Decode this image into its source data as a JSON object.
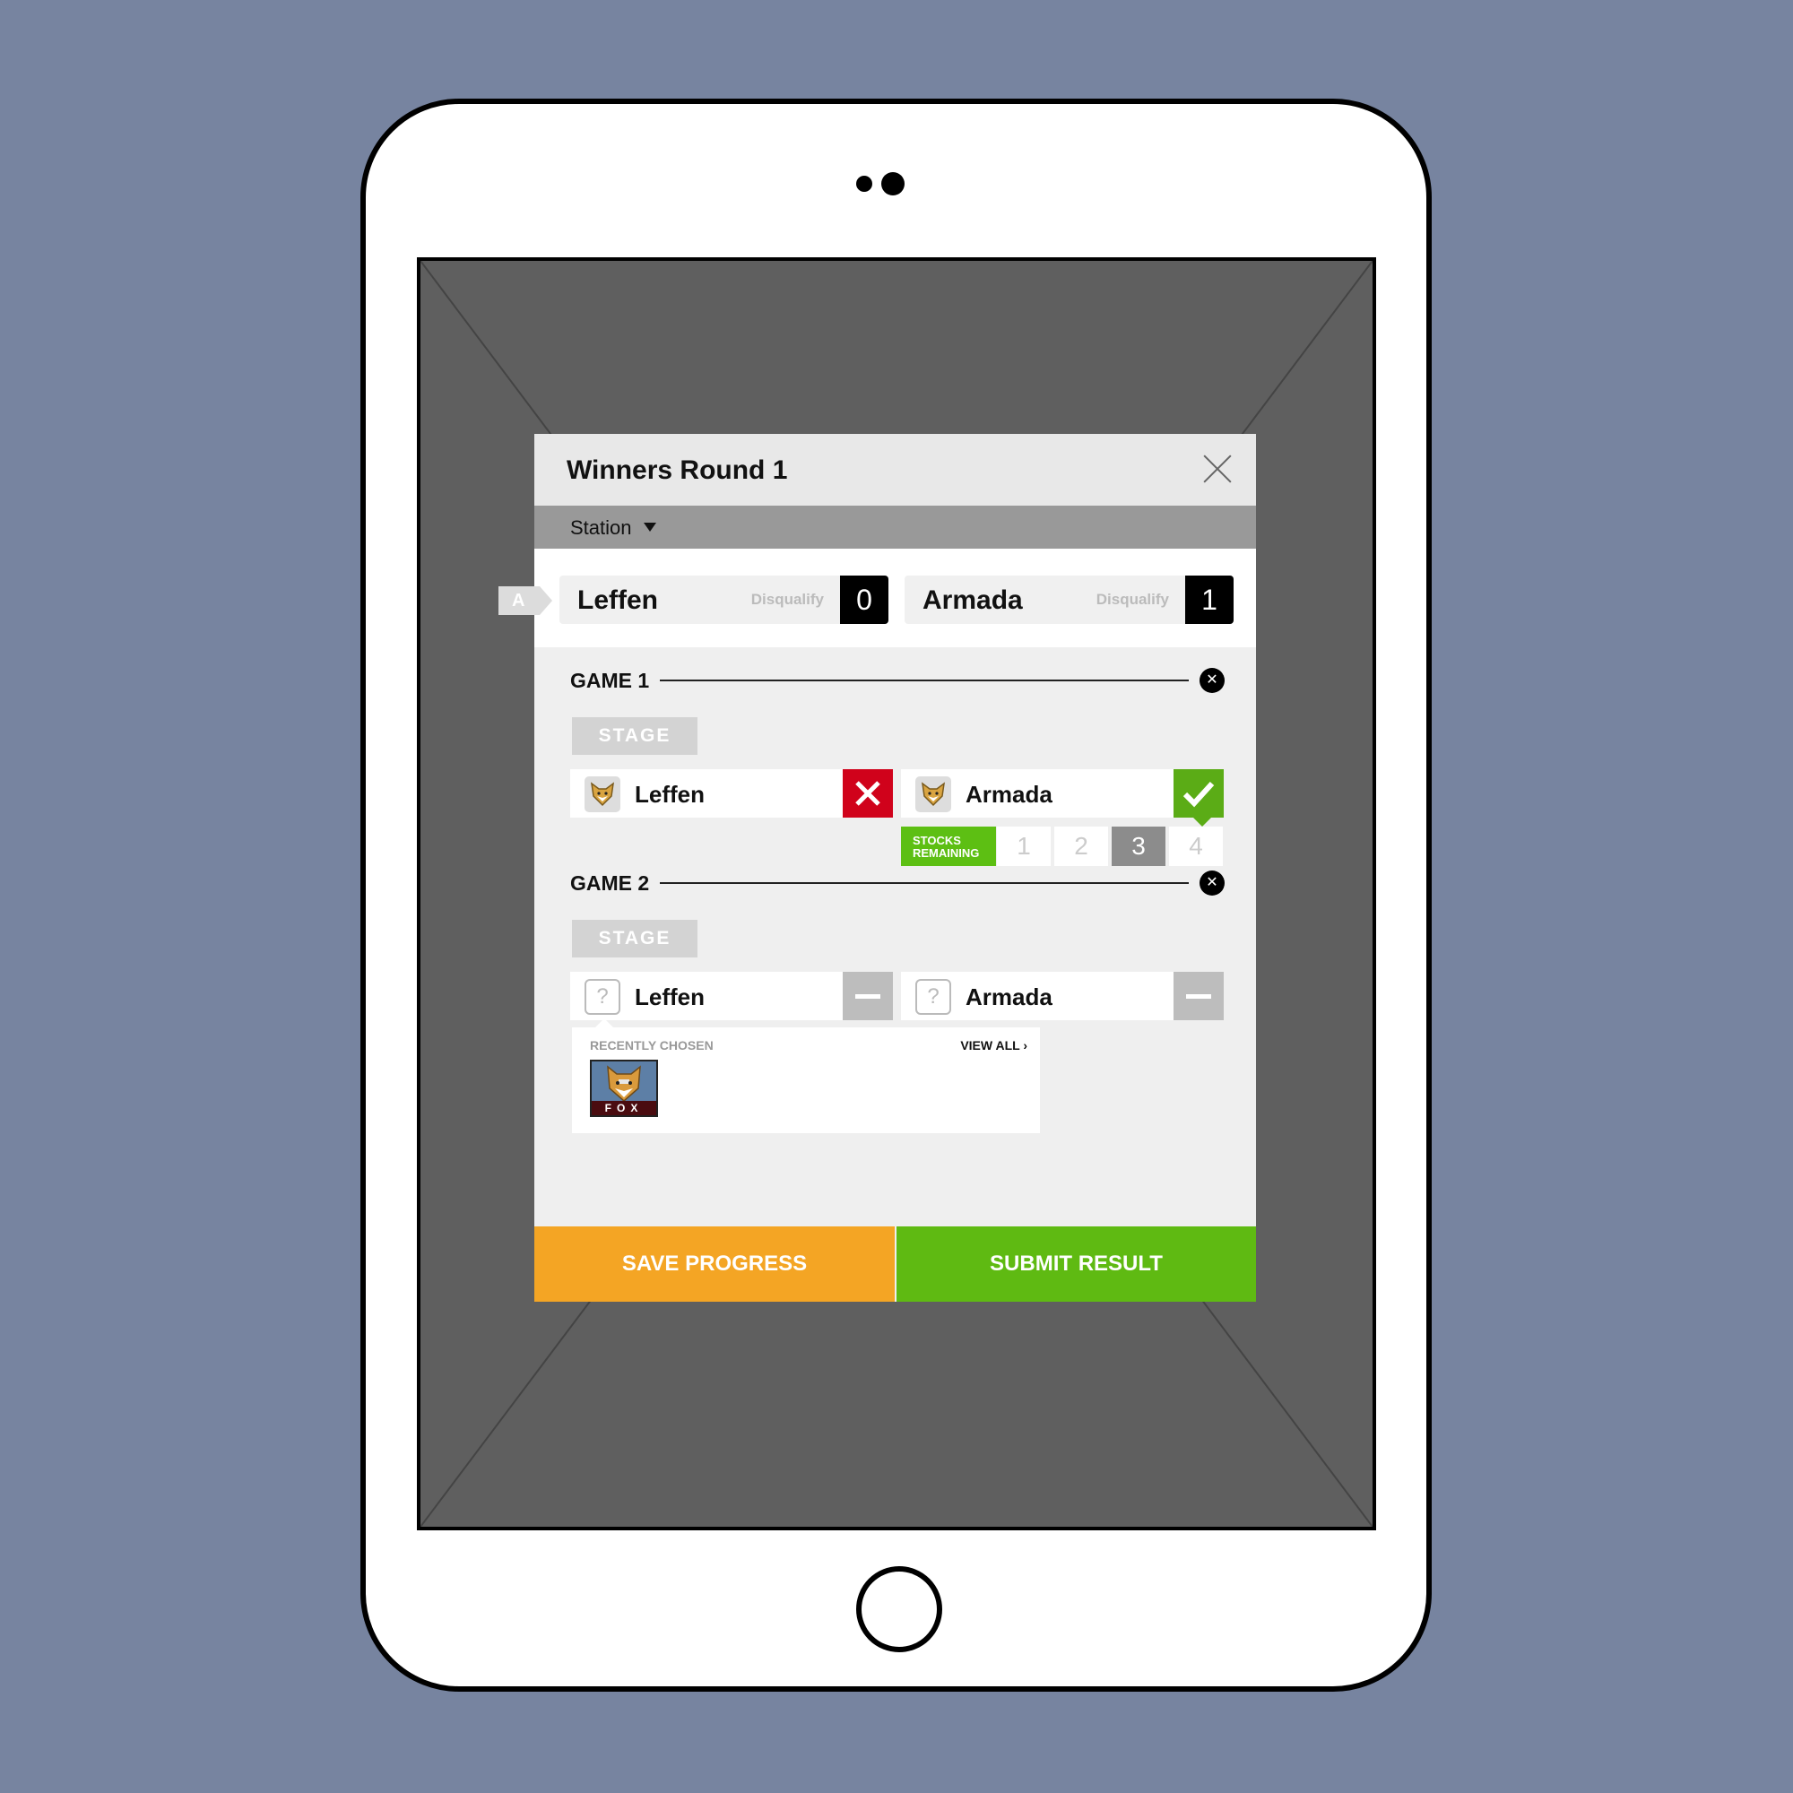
{
  "modal": {
    "title": "Winners Round 1",
    "station_label": "Station",
    "seed_tag": "A"
  },
  "players": [
    {
      "name": "Leffen",
      "disqualify_label": "Disqualify",
      "score": "0"
    },
    {
      "name": "Armada",
      "disqualify_label": "Disqualify",
      "score": "1"
    }
  ],
  "games": [
    {
      "title": "GAME 1",
      "stage_label": "STAGE",
      "left": {
        "name": "Leffen",
        "character_icon": "fox-icon",
        "result": "loss"
      },
      "right": {
        "name": "Armada",
        "character_icon": "fox-icon",
        "result": "win"
      },
      "stocks_label_line1": "STOCKS",
      "stocks_label_line2": "REMAINING",
      "stocks": [
        "1",
        "2",
        "3",
        "4"
      ],
      "stocks_selected": 3
    },
    {
      "title": "GAME 2",
      "stage_label": "STAGE",
      "left": {
        "name": "Leffen",
        "character_icon": "question-icon",
        "placeholder": "?",
        "result": "none"
      },
      "right": {
        "name": "Armada",
        "character_icon": "question-icon",
        "placeholder": "?",
        "result": "none"
      }
    }
  ],
  "recently_chosen": {
    "label": "RECENTLY CHOSEN",
    "view_all": "VIEW ALL  ›",
    "characters": [
      {
        "banner": "FOX"
      }
    ]
  },
  "actions": {
    "save": "SAVE PROGRESS",
    "submit": "SUBMIT RESULT"
  },
  "colors": {
    "background": "#7784a0",
    "save": "#f4a524",
    "submit": "#5fba12",
    "win": "#5bac16",
    "loss": "#d0021b"
  }
}
